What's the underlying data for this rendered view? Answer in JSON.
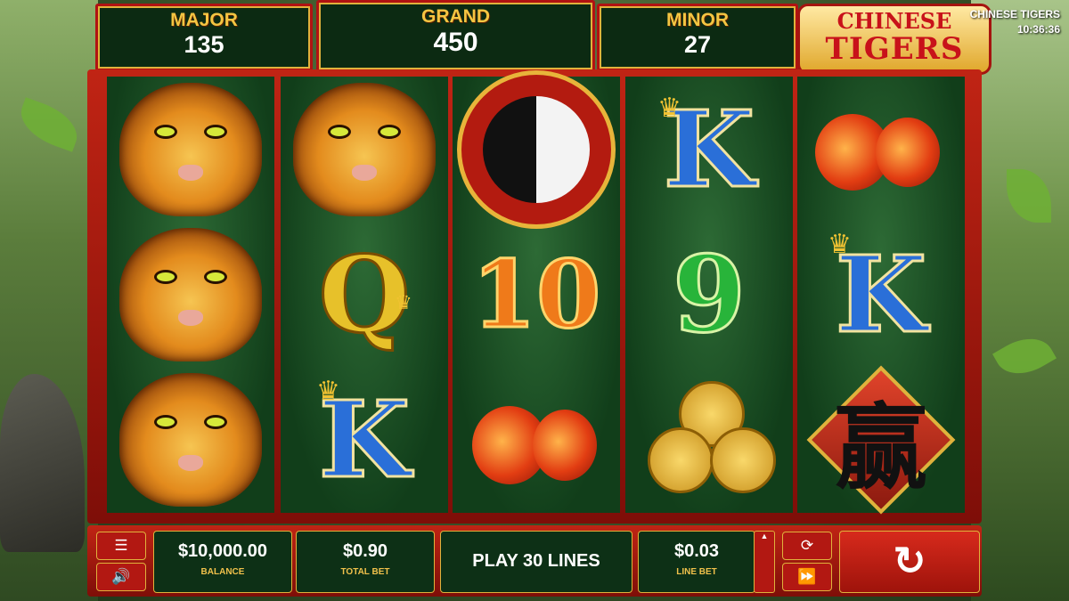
{
  "jackpots": {
    "major": {
      "label": "MAJOR",
      "value": "135"
    },
    "grand": {
      "label": "GRAND",
      "value": "450"
    },
    "minor": {
      "label": "MINOR",
      "value": "27"
    }
  },
  "logo": {
    "line1": "CHINESE",
    "line2": "TIGERS"
  },
  "header": {
    "game_title": "CHINESE TIGERS",
    "clock": "10:36:36"
  },
  "reels": [
    [
      "tiger",
      "tiger",
      "tiger"
    ],
    [
      "tiger",
      "Q",
      "K"
    ],
    [
      "yin-yang",
      "10",
      "lanterns"
    ],
    [
      "K",
      "9",
      "coins"
    ],
    [
      "lanterns",
      "K",
      "win-symbol"
    ]
  ],
  "symbol_text": {
    "K": "K",
    "Q": "Q",
    "ten": "10",
    "nine": "9",
    "win": "赢"
  },
  "controls": {
    "balance_value": "$10,000.00",
    "balance_label": "BALANCE",
    "total_bet_value": "$0.90",
    "total_bet_label": "TOTAL BET",
    "lines_label": "PLAY 30 LINES",
    "line_bet_value": "$0.03",
    "line_bet_label": "LINE BET",
    "menu_icon": "menu-icon",
    "sound_icon": "speaker-icon",
    "autoplay_icon": "refresh-icon",
    "fast_icon": "fast-forward-icon",
    "spin_icon": "spin-icon"
  },
  "colors": {
    "frame_red": "#c02414",
    "reel_green": "#113e1a",
    "gold": "#e0b23c",
    "panel_green": "#0d3016"
  }
}
